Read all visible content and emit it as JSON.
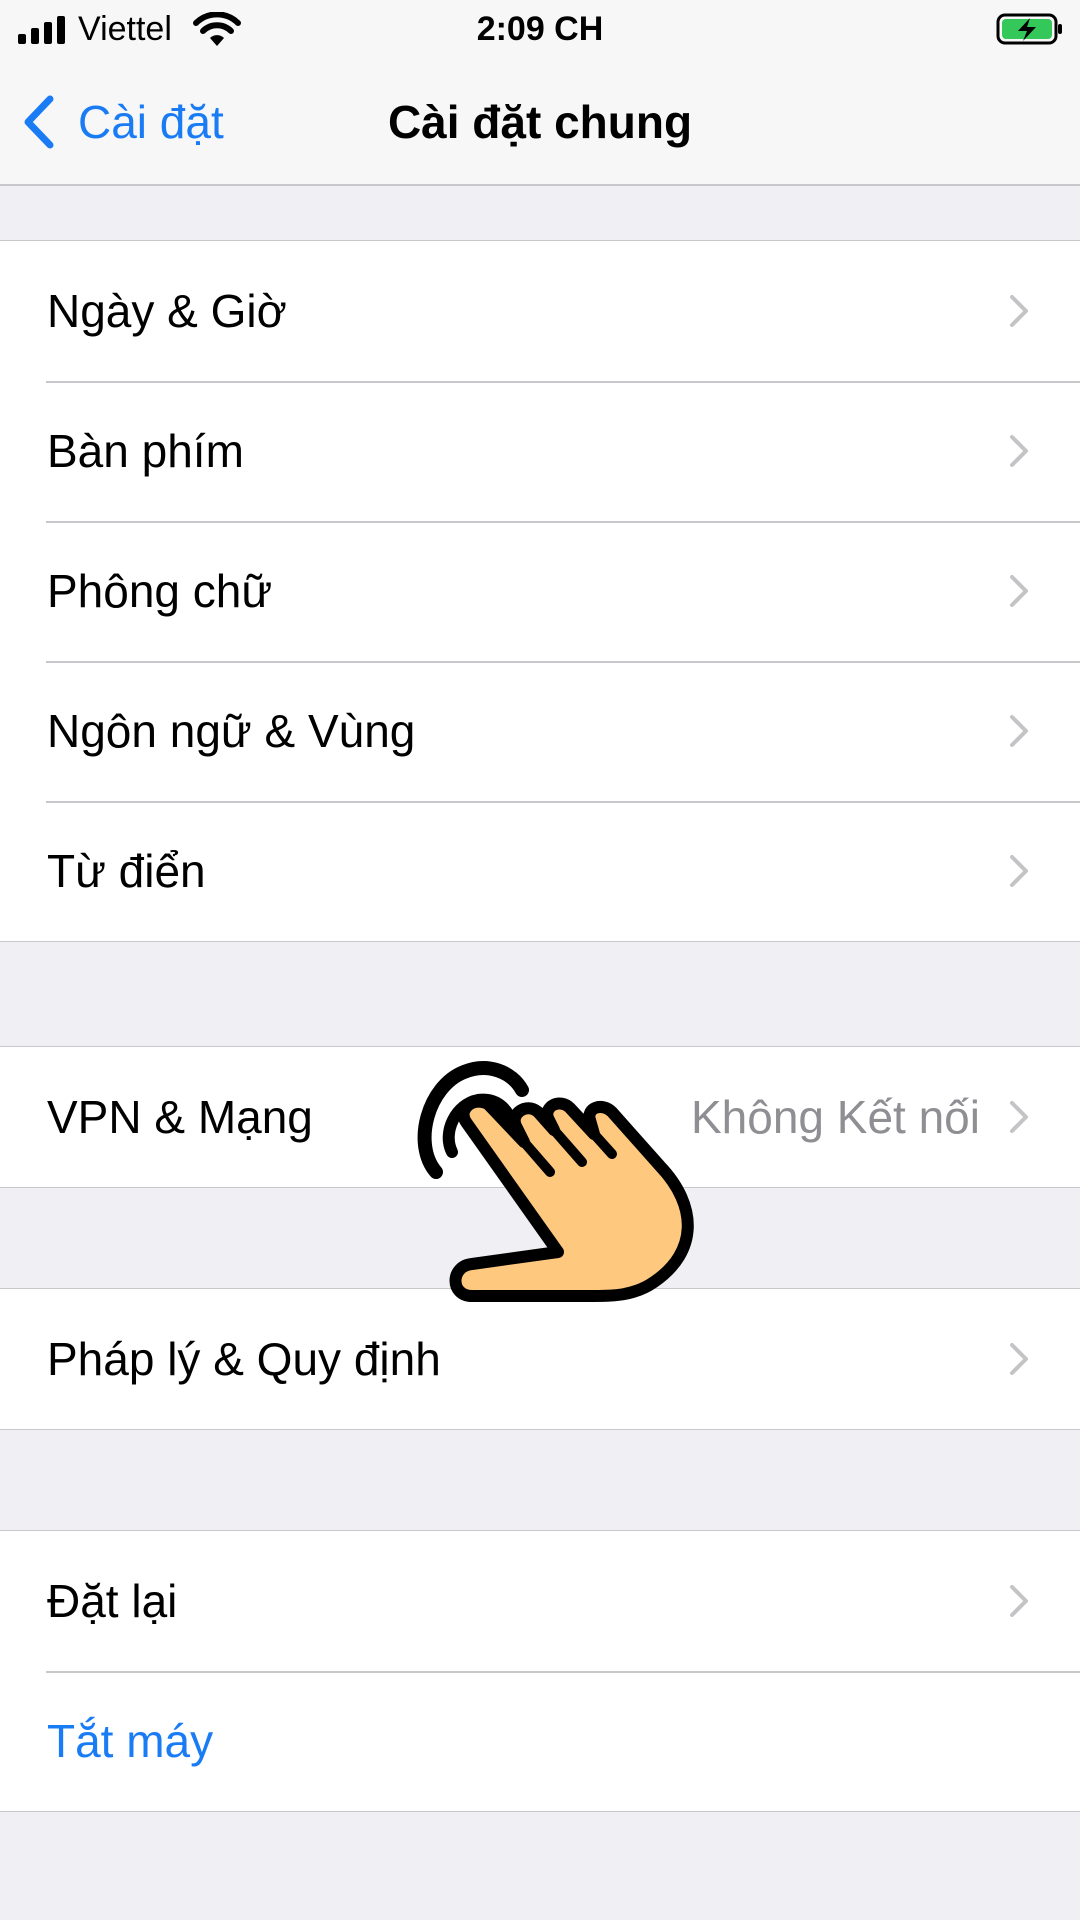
{
  "status_bar": {
    "carrier": "Viettel",
    "time": "2:09 CH",
    "signal_icon": "signal-bars-icon",
    "wifi_icon": "wifi-icon",
    "battery_icon": "battery-charging-icon"
  },
  "nav": {
    "back_label": "Cài đặt",
    "title": "Cài đặt chung"
  },
  "groups": [
    {
      "items": [
        {
          "label": "Ngày & Giờ"
        },
        {
          "label": "Bàn phím"
        },
        {
          "label": "Phông chữ"
        },
        {
          "label": "Ngôn ngữ & Vùng"
        },
        {
          "label": "Từ điển"
        }
      ]
    },
    {
      "items": [
        {
          "label": "VPN & Mạng",
          "detail": "Không Kết nối"
        }
      ]
    },
    {
      "items": [
        {
          "label": "Pháp lý & Quy định"
        }
      ]
    },
    {
      "items": [
        {
          "label": "Đặt lại"
        },
        {
          "label": "Tắt máy"
        }
      ]
    }
  ],
  "colors": {
    "accent": "#1a7cf5",
    "background": "#efeff4",
    "separator": "#c8c7cc",
    "detail_text": "#8e8e93",
    "battery_green": "#34c759",
    "hand_fill": "#fec87f"
  },
  "overlay": {
    "hand_icon": "pointing-hand-icon"
  }
}
